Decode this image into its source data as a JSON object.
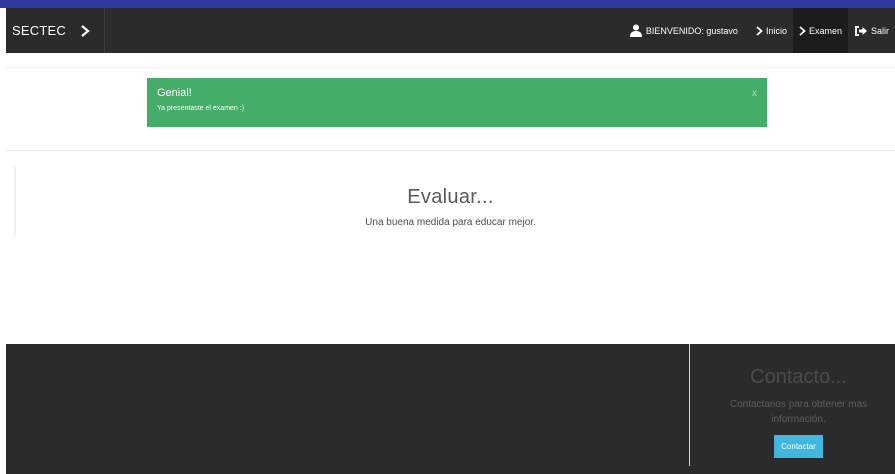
{
  "navbar": {
    "brand": "SECTEC",
    "user_label": "BIENVENIDO: gustavo",
    "items": [
      {
        "label": "Inicio",
        "icon": "chevron-right-icon"
      },
      {
        "label": "Examen",
        "icon": "chevron-right-icon"
      },
      {
        "label": "Salir",
        "icon": "sign-out-icon"
      }
    ]
  },
  "alert": {
    "title": "Genial!",
    "text": "Ya presentaste el examen :)",
    "close": "x",
    "color": "#44ad6a"
  },
  "hero": {
    "title": "Evaluar...",
    "subtitle": "Una buena medida para educar mejor."
  },
  "footer": {
    "contact_title": "Contacto...",
    "contact_text": "Contactanos para obtener mas información.",
    "contact_button": "Contactar",
    "button_color": "#42b7de"
  },
  "colors": {
    "topbar": "#2f3aa0",
    "navbar": "#2b2b2b",
    "footer": "#2b2b2b"
  }
}
